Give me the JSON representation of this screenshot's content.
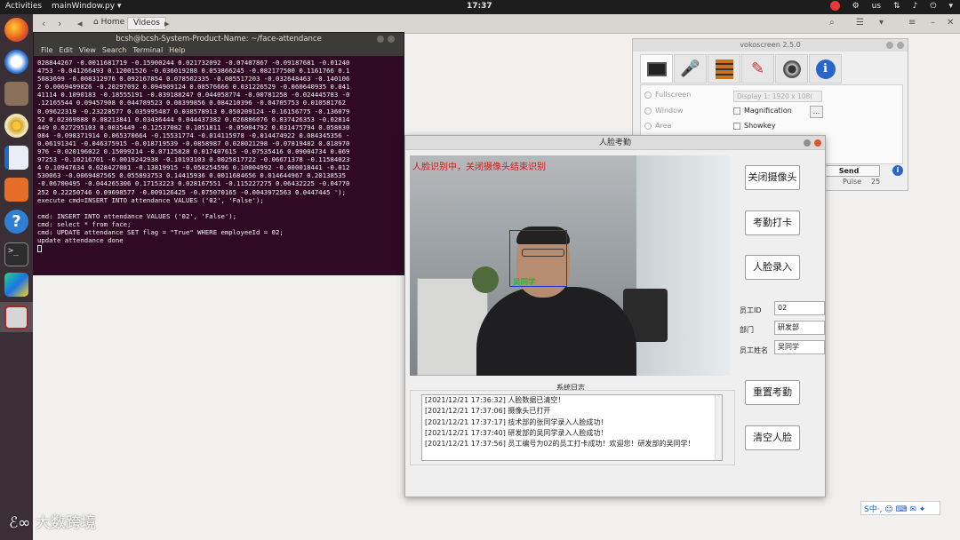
{
  "topbar": {
    "activities": "Activities",
    "app": "mainWindow.py ▾",
    "clock": "17:37",
    "lang": "us",
    "menu_arrow": "▾"
  },
  "files": {
    "back": "‹",
    "forward": "›",
    "home": "Home",
    "videos": "Videos"
  },
  "terminal": {
    "title": "bcsh@bcsh-System-Product-Name: ~/face-attendance",
    "menu": [
      "File",
      "Edit",
      "View",
      "Search",
      "Terminal",
      "Help"
    ],
    "output": "028844267 -0.0011681719 -0.15900244 0.021732092 -0.07407867 -0.09187681 -0.01240\n4753 -0.041266493 0.12001526 -0.036019288 0.053866245 -0.082177500 0.1161766 0.1\n5083699 -0.008312976 0.092167854 0.078502335 -0.005517203 -0.032648463 -0.140106\n2 0.0069499826 -0.20297092 0.094909124 0.08576666 0.031226529 -0.060640935 0.041\n41114 0.1090183 -0.18555191 -0.039188247 0.044058774 -0.00781258 -0.024445783 -0\n.12165544 0.09457908 0.044789523 0.08399856 0.084210396 -0.04705753 0.010581762\n0.09622319 -0.23228577 0.035995487 0.038578913 0.050209124 -0.16156775 -0.136079\n52 0.02369888 0.08213841 0.03436444 0.044437382 0.026886076 0.037426353 -0.02814\n449 0.027295103 0.0035449 -0.12537082 0.1051811 -0.05004792 0.031475794 0.058830\n084 -0.098371914 0.065370664 -0.15531774 -0.014115978 -0.014474922 0.084345356 -\n0.06191341 -0.046375915 -0.018719539 -0.0858987 0.028021298 -0.07819482 0.018970\n976 -0.020196022 0.15099214 -0.07125828 0.017407615 -0.07535416 0.09004734 0.069\n97253 -0.10216701 -0.0019242938 -0.10193103 0.0025817722 -0.06671378 -0.11584023\n4 0.10947634 0.028427081 -0.13819915 -0.058254596 0.10004992 -0.000018441 -0.012\n530063 -0.0069487565 0.055893753 0.14415936 0.0011684656 0.014644967 0.20138535\n-0.06700495 -0.044265306 0.17153223 0.028167551 -0.115227275 0.06432225 -0.04770\n252 0.22250746 0.09698577 -0.009126425 -0.075070165 -0.0043972563 0.0447445 ');\nexecute cmd=INSERT INTO attendance VALUES ('02', 'False');\n\ncmd: INSERT INTO attendance VALUES ('02', 'False');\ncmd: select * from face;\ncmd: UPDATE attendance SET flag = \"True\" WHERE employeeId = 02;\nupdate attendance done\n"
  },
  "voko": {
    "title": "vokoscreen 2.5.0",
    "fullscreen": "Fullscreen",
    "window": "Window",
    "area": "Area",
    "display": "Display 1:  1920 x 108(",
    "magnification": "Magnification",
    "showkey": "Showkey",
    "ellipsis": "...",
    "send": "Send",
    "pulse_label": "Pulse",
    "pulse_value": "25",
    "info": "i"
  },
  "app": {
    "title": "人脸考勤",
    "overlay": "人脸识别中，关闭摄像头结束识别",
    "face_label": "吴同学",
    "buttons": {
      "close_camera": "关闭摄像头",
      "check_in": "考勤打卡",
      "enroll": "人脸录入",
      "reset": "重置考勤",
      "clear": "清空人脸"
    },
    "fields": {
      "id_label": "员工ID",
      "id_value": "02",
      "dept_label": "部门",
      "dept_value": "研发部",
      "name_label": "员工姓名",
      "name_value": "吴同学"
    },
    "log_title": "系统日志",
    "log": [
      "[2021/12/21 17:36:32] 人脸数据已清空！",
      "[2021/12/21 17:37:06] 摄像头已打开",
      "[2021/12/21 17:37:17] 技术部的张同学录入人脸成功！",
      "[2021/12/21 17:37:40] 研发部的吴同学录入人脸成功！",
      "[2021/12/21 17:37:56] 员工编号为02的员工打卡成功！欢迎您！研发部的吴同学！"
    ]
  },
  "watermark": "大数跨境",
  "ime": "S中·, ☺ ⌨ ✉ ✦",
  "colors": {
    "terminal_bg": "#300a24",
    "dock_bg": "#3b2f36",
    "overlay_red": "#d11b1b",
    "face_box": "#1d34d6",
    "face_label": "#18b12b"
  }
}
